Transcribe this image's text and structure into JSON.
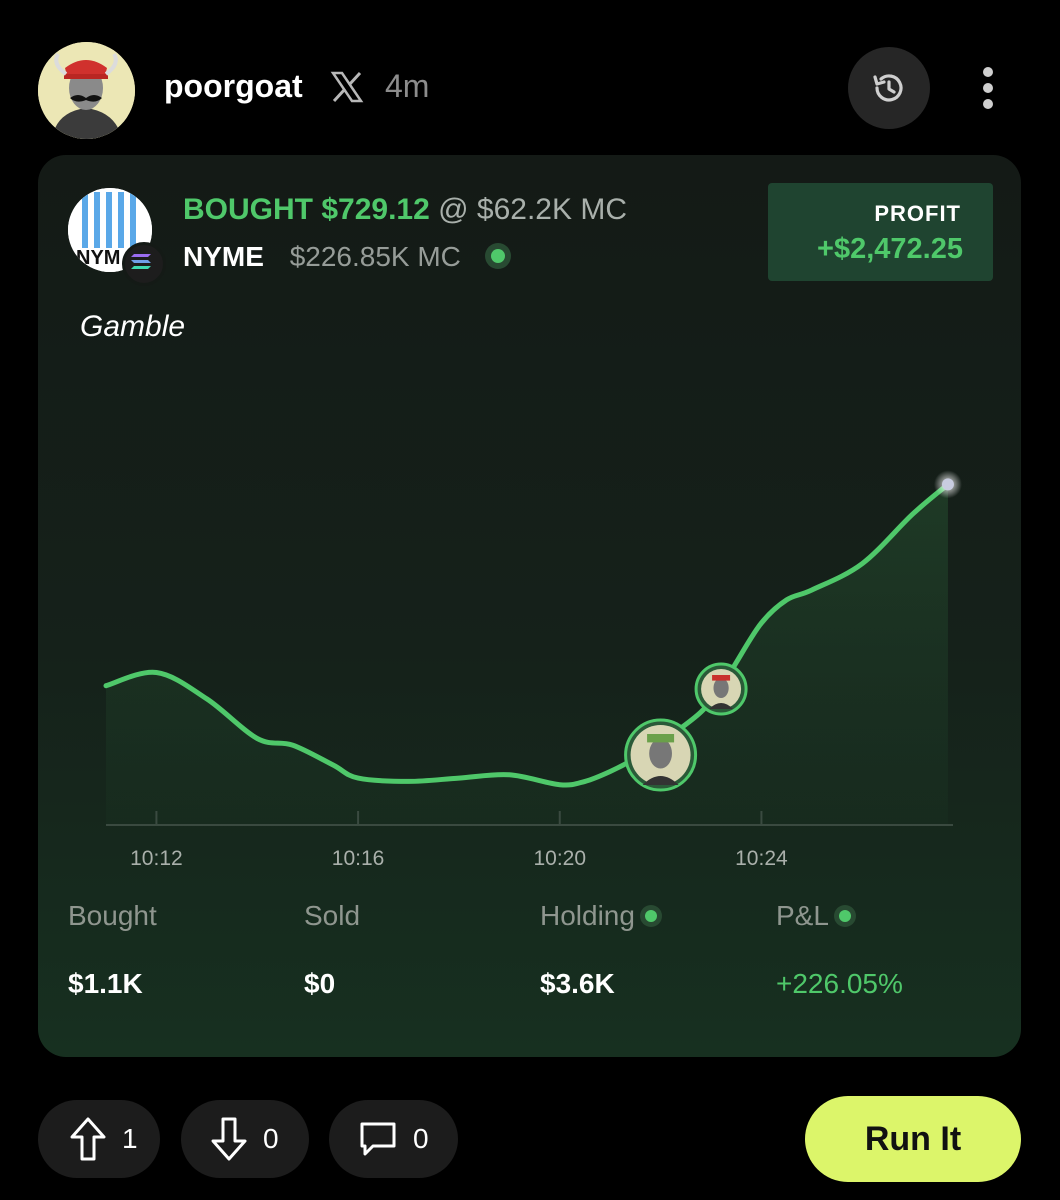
{
  "post": {
    "username": "poorgoat",
    "time": "4m"
  },
  "trade": {
    "action": "BOUGHT $729.12",
    "at": "@ $62.2K MC",
    "symbol": "NYME",
    "market_cap": "$226.85K MC",
    "profit_label": "PROFIT",
    "profit_value": "+$2,472.25",
    "note": "Gamble"
  },
  "chart_data": {
    "type": "area",
    "x_tick_labels": [
      "10:12",
      "10:16",
      "10:20",
      "10:24"
    ],
    "x_ticks": [
      12,
      16,
      20,
      24
    ],
    "x_range": [
      11,
      27.8
    ],
    "y_range": [
      0,
      100
    ],
    "series": [
      {
        "x": [
          11,
          12,
          13,
          14,
          14.7,
          15.5,
          16,
          17,
          18,
          19,
          20,
          20.5,
          21,
          21.5,
          22,
          22.3,
          22.8,
          23.2,
          23.5,
          24,
          24.5,
          25,
          26,
          27,
          27.7
        ],
        "y": [
          41,
          45,
          37,
          25,
          23,
          17,
          13,
          12,
          13,
          14,
          11,
          12,
          15,
          19,
          24,
          27,
          33,
          40,
          48,
          60,
          67,
          70,
          78,
          93,
          102
        ]
      }
    ],
    "color": "#4fc86a",
    "markers": [
      {
        "x": 22,
        "y": 20,
        "label": "buy"
      },
      {
        "x": 23.2,
        "y": 40,
        "label": "buy"
      }
    ]
  },
  "stats": [
    {
      "label": "Bought",
      "value": "$1.1K",
      "dot": false,
      "green": false
    },
    {
      "label": "Sold",
      "value": "$0",
      "dot": false,
      "green": false
    },
    {
      "label": "Holding",
      "value": "$3.6K",
      "dot": true,
      "green": false
    },
    {
      "label": "P&L",
      "value": "+226.05%",
      "dot": true,
      "green": true
    }
  ],
  "actions": {
    "upvotes": "1",
    "downvotes": "0",
    "comments": "0",
    "run_label": "Run It"
  },
  "colors": {
    "accent": "#4fc86a",
    "run_button": "#dcf56a",
    "profit_bg": "#1f4430"
  }
}
